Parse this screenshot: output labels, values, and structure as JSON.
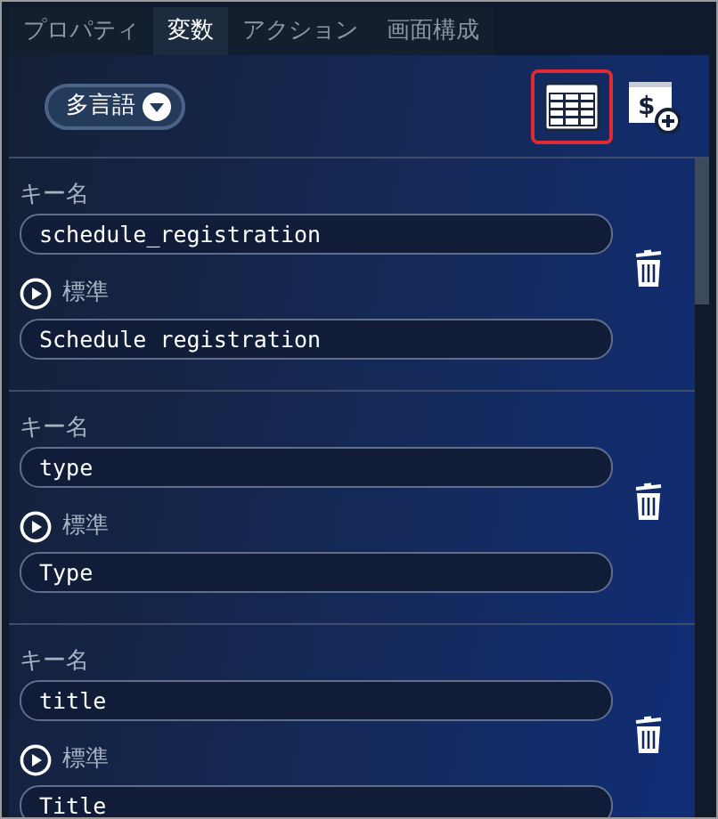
{
  "tabs": [
    {
      "label": "プロパティ",
      "selected": false
    },
    {
      "label": "変数",
      "selected": true
    },
    {
      "label": "アクション",
      "selected": false
    },
    {
      "label": "画面構成",
      "selected": false
    }
  ],
  "toolbar": {
    "language_button": "多言語",
    "tools": [
      {
        "kind": "table",
        "highlighted": true
      },
      {
        "kind": "add-variable",
        "highlighted": false,
        "symbol": "$"
      }
    ]
  },
  "variables": [
    {
      "key_label": "キー名",
      "key": "schedule_registration",
      "lang_label": "標準",
      "value": "Schedule registration"
    },
    {
      "key_label": "キー名",
      "key": "type",
      "lang_label": "標準",
      "value": "Type"
    },
    {
      "key_label": "キー名",
      "key": "title",
      "lang_label": "標準",
      "value": "Title"
    }
  ]
}
